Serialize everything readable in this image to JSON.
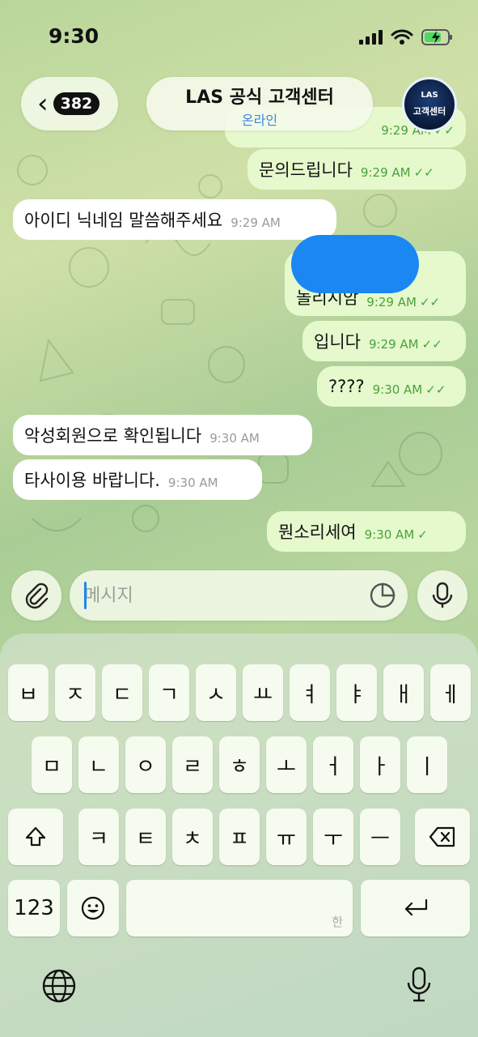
{
  "status_bar": {
    "time": "9:30"
  },
  "header": {
    "unread_count": "382",
    "title": "LAS 공식 고객센터",
    "subtitle": "온라인",
    "avatar_top": "LAS",
    "avatar_text": "고객센터"
  },
  "messages": [
    {
      "dir": "out",
      "text": "문의드립니다",
      "time": "9:29 AM",
      "checks": "double"
    },
    {
      "dir": "in",
      "text": "아이디 닉네임 말씀해주세요",
      "time": "9:29 AM"
    },
    {
      "dir": "out",
      "text": "놀리시암",
      "time": "9:29 AM",
      "checks": "double",
      "redacted": true
    },
    {
      "dir": "out",
      "text": "입니다",
      "time": "9:29 AM",
      "checks": "double"
    },
    {
      "dir": "out",
      "text": "????",
      "time": "9:30 AM",
      "checks": "double"
    },
    {
      "dir": "in",
      "text": "악성회원으로 확인됩니다",
      "time": "9:30 AM"
    },
    {
      "dir": "in",
      "text": "타사이용 바랍니다.",
      "time": "9:30 AM"
    },
    {
      "dir": "out",
      "text": "뭔소리세여",
      "time": "9:30 AM",
      "checks": "single"
    }
  ],
  "input": {
    "placeholder": "메시지",
    "value": ""
  },
  "keyboard": {
    "row1": [
      "ㅂ",
      "ㅈ",
      "ㄷ",
      "ㄱ",
      "ㅅ",
      "ㅛ",
      "ㅕ",
      "ㅑ",
      "ㅐ",
      "ㅔ"
    ],
    "row2": [
      "ㅁ",
      "ㄴ",
      "ㅇ",
      "ㄹ",
      "ㅎ",
      "ㅗ",
      "ㅓ",
      "ㅏ",
      "ㅣ"
    ],
    "row3": [
      "ㅋ",
      "ㅌ",
      "ㅊ",
      "ㅍ",
      "ㅠ",
      "ㅜ",
      "ㅡ"
    ],
    "numbers_label": "123",
    "space_hint": "한"
  },
  "colors": {
    "incoming_bubble": "#ffffff",
    "outgoing_bubble": "#e5f9cd",
    "outgoing_meta": "#4aa23a",
    "accent": "#3a86d9",
    "redaction": "#1b87f3"
  }
}
